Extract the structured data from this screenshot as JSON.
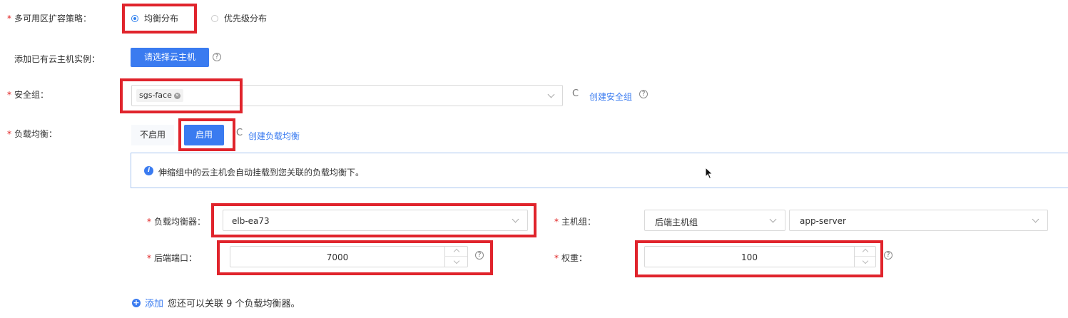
{
  "strategy": {
    "label": "多可用区扩容策略：",
    "options": [
      {
        "label": "均衡分布",
        "selected": true
      },
      {
        "label": "优先级分布",
        "selected": false
      }
    ]
  },
  "add_instance": {
    "label": "添加已有云主机实例：",
    "button_label": "请选择云主机",
    "help": "?"
  },
  "security_group": {
    "label": "安全组：",
    "tag": "sgs-face",
    "refresh": "C",
    "create_link": "创建安全组",
    "help": "?"
  },
  "load_balance": {
    "label": "负载均衡：",
    "toggle_off": "不启用",
    "toggle_on": "启用",
    "refresh": "C",
    "create_link": "创建负载均衡",
    "info_icon": "i",
    "info_text": "伸缩组中的云主机会自动挂载到您关联的负载均衡下。",
    "balancer": {
      "label": "负载均衡器：",
      "value": "elb-ea73"
    },
    "host_group": {
      "label": "主机组：",
      "type_value": "后端主机组",
      "value": "app-server"
    },
    "port": {
      "label": "后端端口：",
      "value": "7000"
    },
    "weight": {
      "label": "权重：",
      "value": "100"
    },
    "help": "?",
    "add_link": "添加",
    "add_hint": "您还可以关联 9 个负载均衡器。"
  },
  "colors": {
    "accent": "#3a7bf0",
    "highlight": "#e0242c",
    "required": "#e02020"
  },
  "icons": [
    "radio-icon",
    "help-icon",
    "clear-tag-icon",
    "chevron-down-icon",
    "refresh-icon",
    "info-icon",
    "plus-circle-icon",
    "cursor-icon"
  ]
}
